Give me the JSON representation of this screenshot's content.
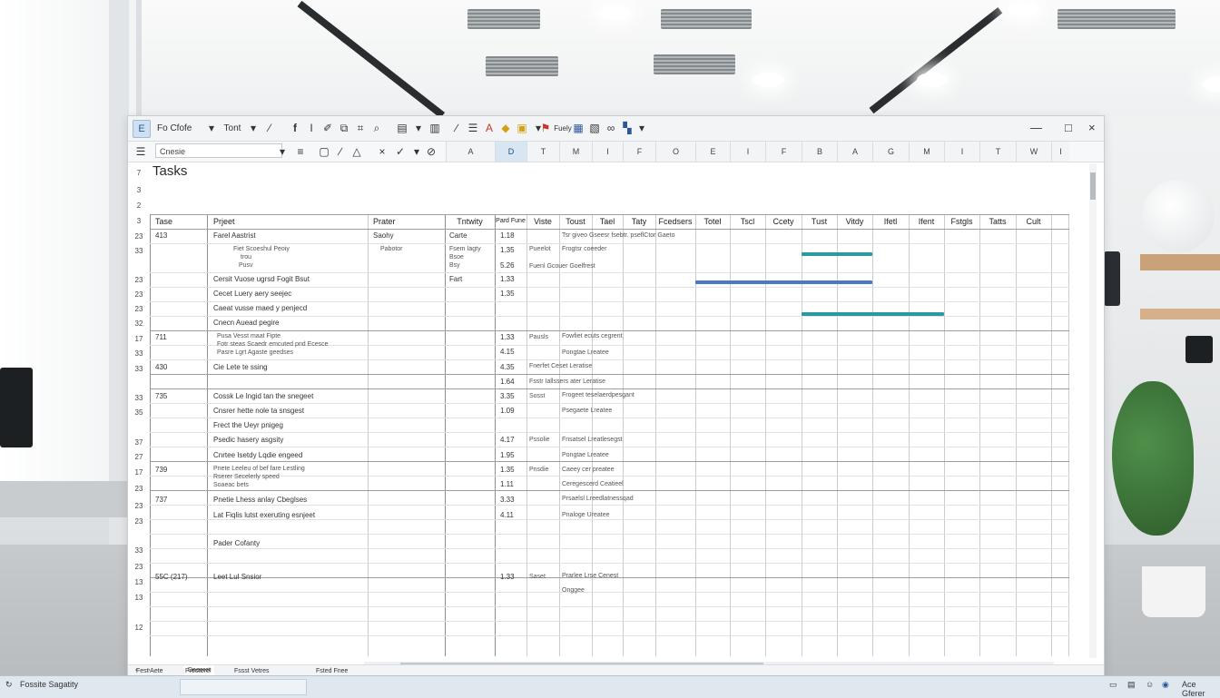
{
  "ribbon": {
    "file_btn": "E",
    "font_name": "Fo Cfofe",
    "font_size": "Tont",
    "bold": "f",
    "italic": "I",
    "insert_label": "Fuely",
    "window": {
      "min": "—",
      "max": "□",
      "close": "×"
    }
  },
  "formula_bar": {
    "name_box": "Cnesie",
    "fx": "≡"
  },
  "column_letters": [
    "A",
    "D",
    "T",
    "M",
    "I",
    "F",
    "O",
    "E",
    "I",
    "F",
    "B",
    "A",
    "G",
    "M",
    "I",
    "T",
    "W",
    "I"
  ],
  "selected_column": "D",
  "title": "Tasks",
  "row_numbers": [
    "7",
    "3",
    "2",
    "3",
    "23",
    "33",
    "23",
    "23",
    "23",
    "32",
    "17",
    "33",
    "33",
    "33",
    "35",
    "37",
    "27",
    "17",
    "23",
    "23",
    "23",
    "33",
    "23",
    "13",
    "13",
    "12"
  ],
  "headers": [
    "Tase",
    "Prjeet",
    "Prater",
    "Tntwity",
    "Pard Fune",
    "Viste",
    "Toust",
    "Tael",
    "Taty",
    "Fcedsers",
    "Totel",
    "Tscl",
    "Ccety",
    "Tust",
    "Vitdy",
    "Ifetl",
    "Ifent",
    "Fstgls",
    "Tatts",
    "Cult"
  ],
  "rows": [
    {
      "id": "413",
      "task": "Farel Aastrist",
      "prater": "Saohy",
      "act": "Carte",
      "dur": "1.18",
      "det": "Tsr giveo Gseesr fsebtr. pseflCtor Gaeto"
    },
    {
      "task": "Fiet Scoeshul Peoiy",
      "task2": "trou",
      "task3": "Pusv",
      "prater": "Pabotor",
      "act": "Fsem Iagty",
      "act2": "Bsoe",
      "act3": "Bsy",
      "dur": "1.35",
      "dur2": "5.26",
      "vis": "Pueelot",
      "det": "Frogtsr coeeder",
      "det2": "Fuenl Gcouer Goelfrest"
    },
    {
      "task": "Cersit Vuose ugrsd Fogit Bsut",
      "act": "Fart",
      "dur": "1.33"
    },
    {
      "task": "Cecet Luery aery seejec",
      "dur": "1.35"
    },
    {
      "task": "Caeat vusse maed y penjecd"
    },
    {
      "task": "Cnecn Auead pegire"
    },
    {
      "id": "711",
      "task": "Pusa Vesst maat Fipte",
      "task2": "Fotr steas Scaedr emcuted pnd Ecesce",
      "task3": "Pasre Lgrt Agaste geedses",
      "dur": "1.33",
      "dur2": "4.15",
      "vis": "Pausls",
      "det": "Fowfiet ecuts cegrent",
      "det2": "Pongtae Lreatee"
    },
    {
      "id": "430",
      "task": "Cie Lete te ssing",
      "dur": "4.35",
      "dur2": "1.64",
      "det": "Fnerfet Ceset Leratise",
      "det2": "Fsstr Iallssers ater Leratise"
    },
    {
      "id": "735",
      "task": "Cossk Le Ingid tan the snegeet",
      "dur": "3.35",
      "vis": "Sosst",
      "det": "Frogeet teselaerdpesgant"
    },
    {
      "task": "Cnsrer hette nole ta snsgest",
      "dur": "1.09",
      "det": "Psegaete Lreatee"
    },
    {
      "task": "Frect the Ueyr pnigeg"
    },
    {
      "task": "Psedic hasery asgsity",
      "dur": "4.17",
      "vis": "Pssolie",
      "det": "Fnsatsel Lreatlesegst"
    },
    {
      "task": "Cnrtee Isetdy Lqdie engeed",
      "dur": "1.95",
      "det": "Pongtae Lreatee"
    },
    {
      "id": "739",
      "task": "Pnete Leeleu of bef fare Lestling",
      "task2": "Rserer Secelerly speed",
      "task3": "Soaeac bets",
      "dur": "1.35",
      "dur2": "1.11",
      "vis": "Pnsdie",
      "det": "Caeey cer preatee",
      "det2": "Ceregescerd Ceatieel"
    },
    {
      "id": "737",
      "task": "Pnetie Lhess anlay Cbeglses",
      "dur": "3.33",
      "det": "Prsaelsl Lreedlatnessqad"
    },
    {
      "task": "Lat Fiqlis lutst exeruting esnjeet",
      "dur": "4.11",
      "det": "Pnaloge Ureatee"
    },
    {
      "task": "Pader Cofanty"
    },
    {
      "id": "55C (217)",
      "task": "Leet Lul Snsior",
      "dur": "1.33",
      "vis": "Saset",
      "det": "Prarlee Lrse Cenest",
      "det2": "Onggee"
    }
  ],
  "gantt": [
    {
      "color": "#2b9a9e"
    },
    {
      "color": "#4a78c2"
    },
    {
      "color": "#2b9a9e"
    }
  ],
  "sheet_tabs": [
    "Deeeret",
    "Fest Aete",
    "Preotere!",
    "Fssst Vetres",
    "Fsted Fnee"
  ],
  "taskbar": {
    "left": "Fossite Sagatity",
    "right": "Ace Gferer"
  }
}
